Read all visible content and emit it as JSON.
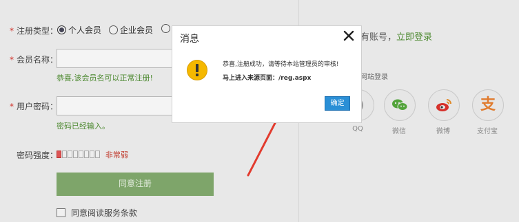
{
  "form": {
    "type_label": "注册类型：",
    "type_options": [
      "个人会员",
      "企业会员"
    ],
    "name_label": "会员名称：",
    "name_hint": "恭喜,该会员名可以正常注册!",
    "pwd_label": "用户密码：",
    "pwd_hint": "密码已经输入。",
    "strength_label": "密码强度：",
    "strength_value": "非常弱",
    "strength_filled": 1,
    "strength_total": 8,
    "submit_label": "同意注册",
    "terms_label": "同意阅读服务条款"
  },
  "right": {
    "account_text": "有账号，",
    "login_link": "立即登录",
    "other_login": "网站登录",
    "socials": [
      {
        "icon": "qq-icon",
        "label": "QQ"
      },
      {
        "icon": "wechat-icon",
        "label": "微信"
      },
      {
        "icon": "weibo-icon",
        "label": "微博"
      },
      {
        "icon": "alipay-icon",
        "label": "支付宝"
      }
    ],
    "alipay_glyph": "支"
  },
  "modal": {
    "title": "消息",
    "close_glyph": "✕",
    "line1": "恭喜,注册成功，请等待本站管理员的审核!",
    "line2": "马上进入来源页面：/reg.aspx",
    "ok_label": "确定"
  },
  "colors": {
    "accent_green": "#4e8a32",
    "button_blue": "#2a8fd6",
    "warning": "#f5b800",
    "arrow_red": "#e23b2e"
  }
}
